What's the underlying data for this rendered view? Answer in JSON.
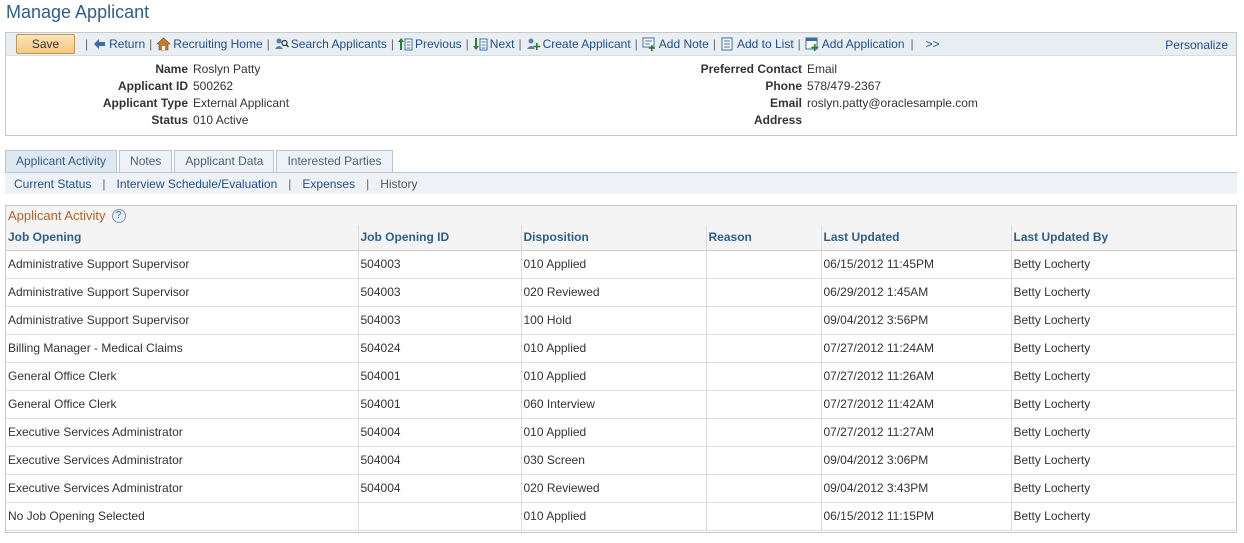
{
  "page": {
    "title": "Manage Applicant"
  },
  "toolbar": {
    "save_label": "Save",
    "return_label": "Return",
    "recruiting_home_label": "Recruiting Home",
    "search_applicants_label": "Search Applicants",
    "previous_label": "Previous",
    "next_label": "Next",
    "create_applicant_label": "Create Applicant",
    "add_note_label": "Add Note",
    "add_to_list_label": "Add to List",
    "add_application_label": "Add Application",
    "more_label": ">>",
    "separator": "|",
    "personalize_label": "Personalize"
  },
  "applicant": {
    "left": [
      {
        "label": "Name",
        "value": "Roslyn Patty"
      },
      {
        "label": "Applicant ID",
        "value": "500262"
      },
      {
        "label": "Applicant Type",
        "value": "External Applicant"
      },
      {
        "label": "Status",
        "value": "010 Active"
      }
    ],
    "right": [
      {
        "label": "Preferred Contact",
        "value": "Email"
      },
      {
        "label": "Phone",
        "value": "578/479-2367"
      },
      {
        "label": "Email",
        "value": "roslyn.patty@oraclesample.com"
      },
      {
        "label": "Address",
        "value": ""
      }
    ]
  },
  "tabs": [
    {
      "label": "Applicant Activity",
      "active": true
    },
    {
      "label": "Notes",
      "active": false
    },
    {
      "label": "Applicant Data",
      "active": false
    },
    {
      "label": "Interested Parties",
      "active": false
    }
  ],
  "subnav": {
    "items": [
      "Current Status",
      "Interview Schedule/Evaluation",
      "Expenses",
      "History"
    ],
    "separator": "|"
  },
  "grid": {
    "title": "Applicant Activity",
    "help_glyph": "?",
    "columns": [
      "Job Opening",
      "Job Opening ID",
      "Disposition",
      "Reason",
      "Last Updated",
      "Last Updated By"
    ],
    "rows": [
      [
        "Administrative Support Supervisor",
        "504003",
        "010 Applied",
        "",
        "06/15/2012 11:45PM",
        "Betty Locherty"
      ],
      [
        "Administrative Support Supervisor",
        "504003",
        "020 Reviewed",
        "",
        "06/29/2012  1:45AM",
        "Betty Locherty"
      ],
      [
        "Administrative Support Supervisor",
        "504003",
        "100 Hold",
        "",
        "09/04/2012  3:56PM",
        "Betty Locherty"
      ],
      [
        "Billing Manager - Medical Claims",
        "504024",
        "010 Applied",
        "",
        "07/27/2012 11:24AM",
        "Betty Locherty"
      ],
      [
        "General Office Clerk",
        "504001",
        "010 Applied",
        "",
        "07/27/2012 11:26AM",
        "Betty Locherty"
      ],
      [
        "General Office Clerk",
        "504001",
        "060 Interview",
        "",
        "07/27/2012 11:42AM",
        "Betty Locherty"
      ],
      [
        "Executive Services Administrator",
        "504004",
        "010 Applied",
        "",
        "07/27/2012 11:27AM",
        "Betty Locherty"
      ],
      [
        "Executive Services Administrator",
        "504004",
        "030 Screen",
        "",
        "09/04/2012  3:06PM",
        "Betty Locherty"
      ],
      [
        "Executive Services Administrator",
        "504004",
        "020 Reviewed",
        "",
        "09/04/2012  3:43PM",
        "Betty Locherty"
      ],
      [
        "No Job Opening Selected",
        "",
        "010 Applied",
        "",
        "06/15/2012 11:15PM",
        "Betty Locherty"
      ]
    ]
  },
  "colors": {
    "title": "#2d5f8a",
    "link": "#1f4e8c",
    "grid_title": "#b4632a",
    "toolbar_bg": "#e9eef3"
  }
}
